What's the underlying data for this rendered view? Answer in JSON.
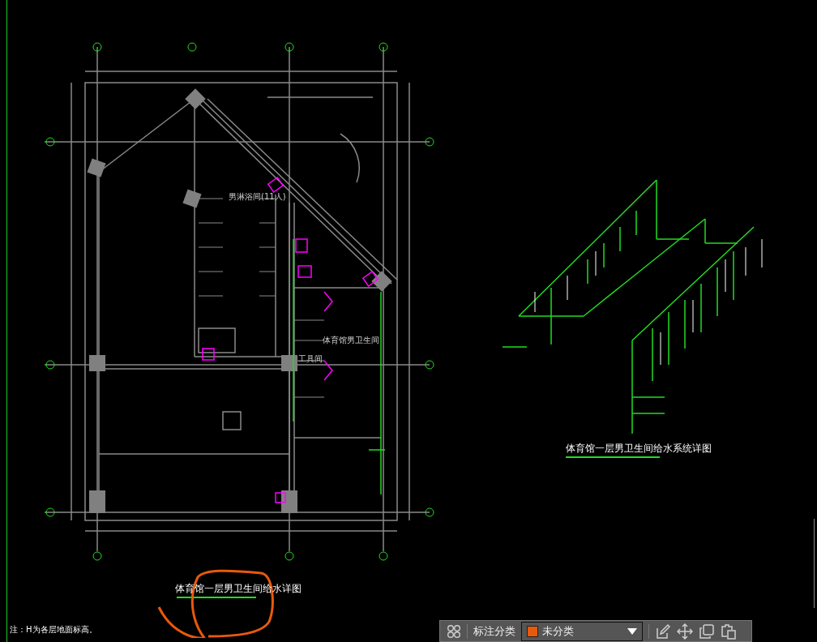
{
  "drawing": {
    "plan_title": "体育馆一层男卫生间给水详图",
    "system_title": "体育馆一层男卫生间给水系统详图",
    "note": "注：H为各层地面标高。",
    "rooms": [
      {
        "label": "男淋浴间(11人)"
      },
      {
        "label": "体育馆男卫生间"
      },
      {
        "label": "工具间"
      }
    ]
  },
  "annotation_toolbar": {
    "label": "标注分类",
    "category": {
      "value": "未分类",
      "color": "#e8590c"
    }
  }
}
